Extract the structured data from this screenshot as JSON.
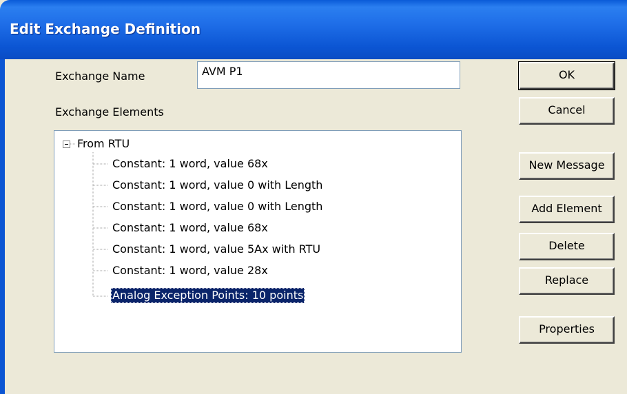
{
  "window": {
    "title": "Edit Exchange Definition"
  },
  "form": {
    "name_label": "Exchange Name",
    "name_value": "AVM P1",
    "elements_label": "Exchange Elements"
  },
  "tree": {
    "root": {
      "expander": "minus",
      "label": "From RTU",
      "children": [
        "Constant: 1 word, value 68x",
        "Constant: 1 word, value 0 with Length",
        "Constant: 1 word, value 0 with Length",
        "Constant: 1 word, value 68x",
        "Constant: 1 word, value 5Ax with RTU",
        "Constant: 1 word, value 28x",
        "Analog Exception Points: 10 points"
      ],
      "selected_index": 6
    }
  },
  "buttons": {
    "ok": "OK",
    "cancel": "Cancel",
    "new_message": "New Message",
    "add_element": "Add Element",
    "delete": "Delete",
    "replace": "Replace",
    "properties": "Properties"
  },
  "colors": {
    "titlebar": "#0b55d3",
    "dialog_bg": "#ece9d8",
    "selection": "#0a246a"
  }
}
